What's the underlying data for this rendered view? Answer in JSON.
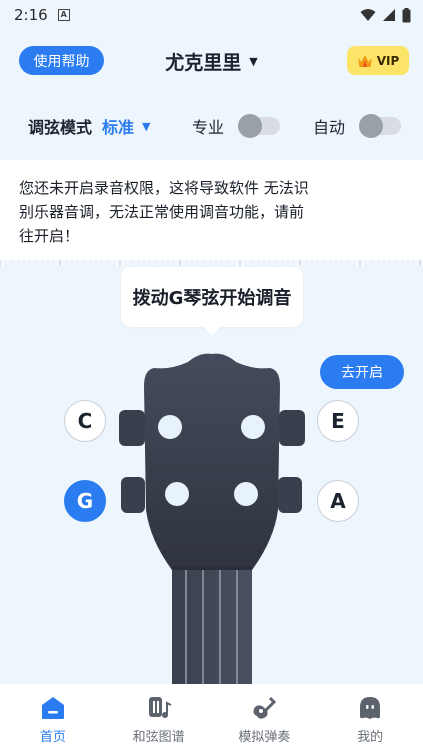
{
  "status_bar": {
    "time": "2:16",
    "sim_label": "A"
  },
  "header": {
    "help_label": "使用帮助",
    "instrument_name": "尤克里里",
    "vip_label": "VIP"
  },
  "mode_row": {
    "mode_label": "调弦模式",
    "mode_value": "标准",
    "pro_label": "专业",
    "auto_label": "自动",
    "pro_enabled": false,
    "auto_enabled": false
  },
  "notice": {
    "message": "您还未开启录音权限，这将导致软件 无法识别乐器音调，无法正常使用调音功能，请前往开启！",
    "open_label": "去开启"
  },
  "prompt": {
    "text": "拨动G琴弦开始调音"
  },
  "strings": {
    "top_left": "C",
    "top_right": "E",
    "bottom_left": "G",
    "bottom_right": "A",
    "active": "G"
  },
  "bottom_nav": {
    "items": [
      {
        "label": "首页",
        "icon": "home-icon",
        "active": true
      },
      {
        "label": "和弦图谱",
        "icon": "chord-chart-icon",
        "active": false
      },
      {
        "label": "模拟弹奏",
        "icon": "guitar-icon",
        "active": false
      },
      {
        "label": "我的",
        "icon": "profile-ghost-icon",
        "active": false
      }
    ]
  },
  "colors": {
    "accent": "#2b7cf0",
    "vip_bg": "#fbe468",
    "background": "#eef6fd",
    "headstock": "#3a3f4d"
  }
}
